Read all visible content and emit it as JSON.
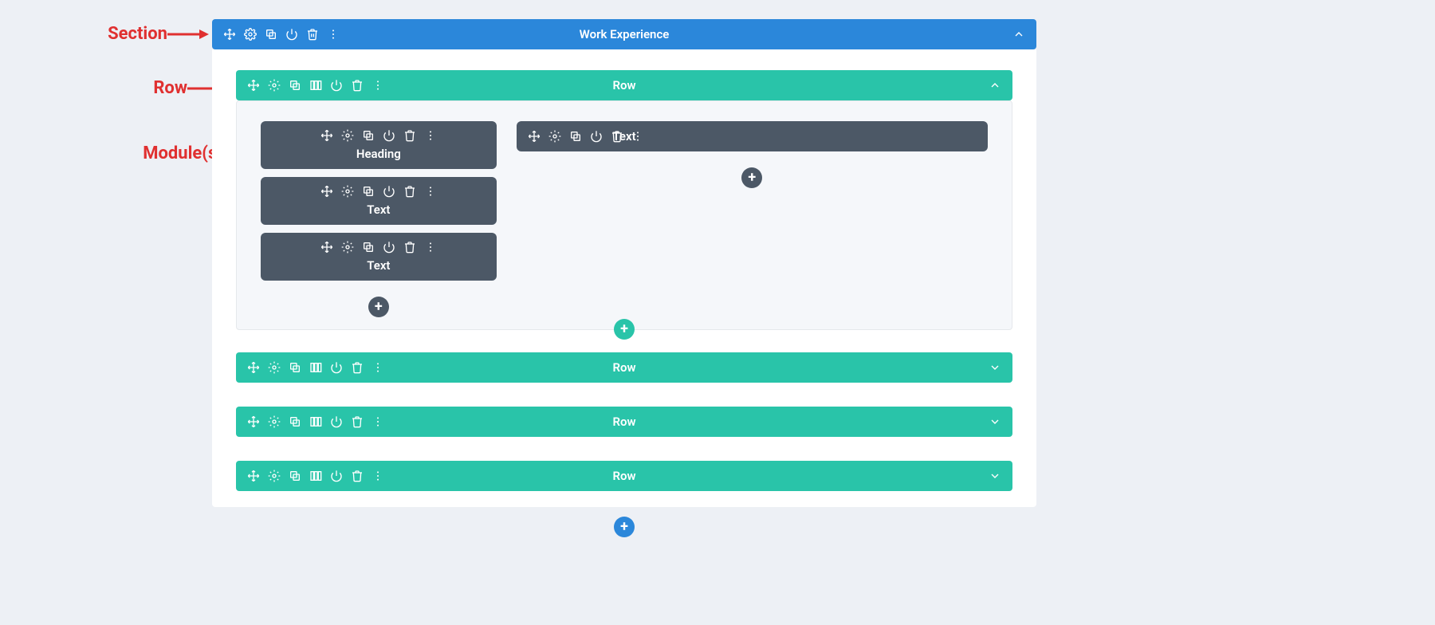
{
  "annotations": {
    "section": "Section",
    "row": "Row",
    "modules": "Module(s)"
  },
  "section": {
    "title": "Work Experience",
    "expanded": true
  },
  "rows": [
    {
      "title": "Row",
      "expanded": true,
      "columns": [
        {
          "modules": [
            {
              "label": "Heading"
            },
            {
              "label": "Text"
            },
            {
              "label": "Text"
            }
          ]
        },
        {
          "modules": [
            {
              "label": "Text"
            }
          ]
        }
      ]
    },
    {
      "title": "Row",
      "expanded": false
    },
    {
      "title": "Row",
      "expanded": false
    },
    {
      "title": "Row",
      "expanded": false
    }
  ],
  "glyphs": {
    "plus": "+"
  },
  "colors": {
    "section": "#2b87da",
    "row": "#29c4a9",
    "module": "#4c5866",
    "annotation": "#e03030"
  }
}
